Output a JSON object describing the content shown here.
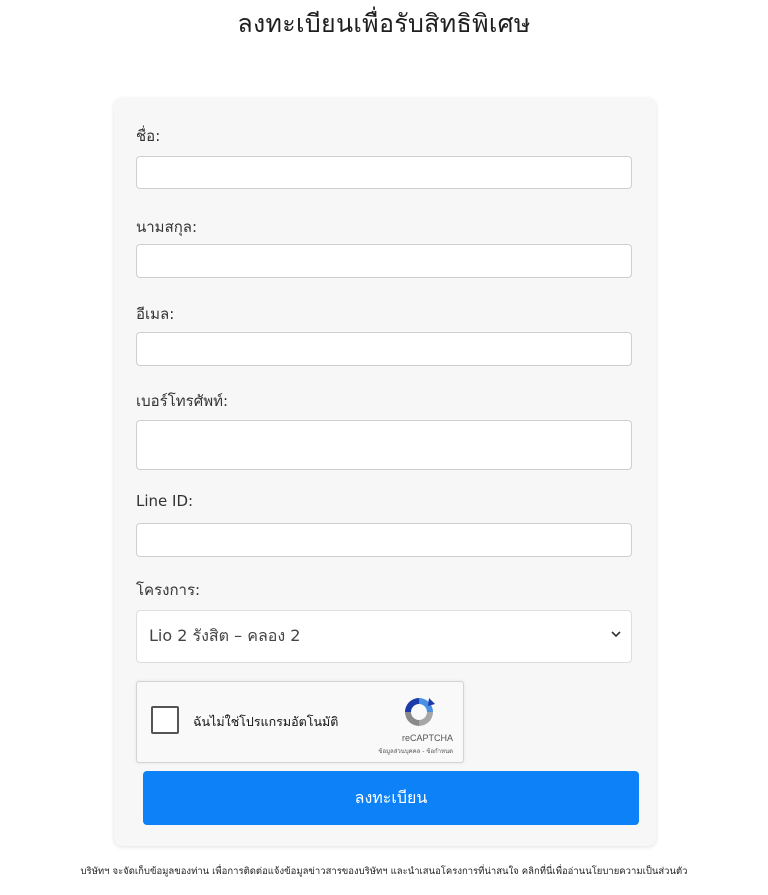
{
  "page": {
    "title": "ลงทะเบียนเพื่อรับสิทธิพิเศษ"
  },
  "form": {
    "first_name": {
      "label": "ชื่อ:",
      "value": ""
    },
    "last_name": {
      "label": "นามสกุล:",
      "value": ""
    },
    "email": {
      "label": "อีเมล:",
      "value": ""
    },
    "phone": {
      "label": "เบอร์โทรศัพท์:",
      "value": ""
    },
    "line_id": {
      "label": "Line ID:",
      "value": ""
    },
    "project": {
      "label": "โครงการ:",
      "selected": "Lio 2 รังสิต – คลอง 2"
    },
    "captcha": {
      "label": "ฉันไม่ใช่โปรแกรมอัตโนมัติ",
      "brand": "reCAPTCHA",
      "terms": "ข้อมูลส่วนบุคคล - ข้อกำหนด"
    },
    "submit_label": "ลงทะเบียน"
  },
  "footer": {
    "text": "บริษัทฯ จะจัดเก็บข้อมูลของท่าน เพื่อการติดต่อแจ้งข้อมูลข่าวสารของบริษัทฯ และนำเสนอโครงการที่น่าสนใจ คลิกที่นี่เพื่ออ่านนโยบายความเป็นส่วนตัว"
  },
  "colors": {
    "primary": "#0d82f8",
    "card_bg": "#f7f7f7"
  }
}
